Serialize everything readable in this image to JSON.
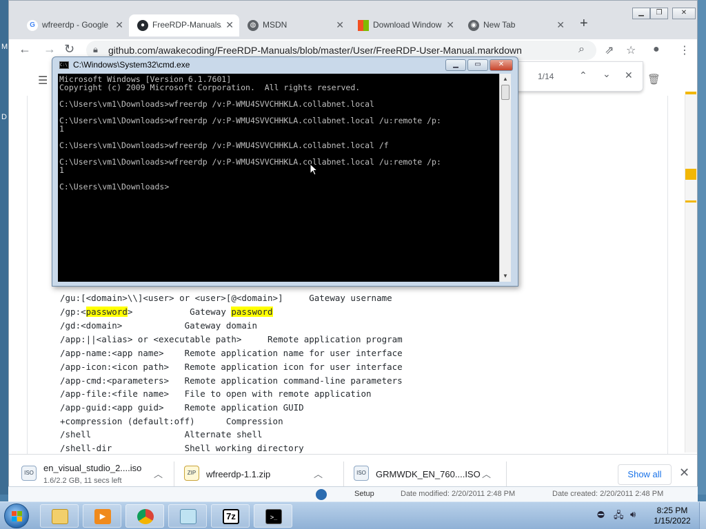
{
  "browser": {
    "tabs": [
      {
        "label": "wfreerdp - Google Search",
        "favicon": "google-icon"
      },
      {
        "label": "FreeRDP-Manuals/FreeRDP-User-Manual.markdown",
        "favicon": "github-icon",
        "active": true
      },
      {
        "label": "MSDN",
        "favicon": "globe-icon"
      },
      {
        "label": "Download Windows",
        "favicon": "microsoft-icon"
      },
      {
        "label": "New Tab",
        "favicon": "chrome-icon"
      }
    ],
    "url": "github.com/awakecoding/FreeRDP-Manuals/blob/master/User/FreeRDP-User-Manual.markdown",
    "find": {
      "count": "1/14"
    }
  },
  "manual": {
    "lines": [
      {
        "pre": "/gu:[<domain>\\\\]<user> or <user>[@<domain>]     Gateway username",
        "hl": "",
        "post": ""
      },
      {
        "pre": "/gp:<",
        "hl": "password",
        "mid": ">           Gateway ",
        "hl2": "password"
      },
      {
        "pre": "/gd:<domain>            Gateway domain",
        "hl": "",
        "post": ""
      },
      {
        "pre": "/app:||<alias> or <executable path>     Remote application program",
        "hl": "",
        "post": ""
      },
      {
        "pre": "/app-name:<app name>    Remote application name for user interface",
        "hl": "",
        "post": ""
      },
      {
        "pre": "/app-icon:<icon path>   Remote application icon for user interface",
        "hl": "",
        "post": ""
      },
      {
        "pre": "/app-cmd:<parameters>   Remote application command-line parameters",
        "hl": "",
        "post": ""
      },
      {
        "pre": "/app-file:<file name>   File to open with remote application",
        "hl": "",
        "post": ""
      },
      {
        "pre": "/app-guid:<app guid>    Remote application GUID",
        "hl": "",
        "post": ""
      },
      {
        "pre": "+compression (default:off)      Compression",
        "hl": "",
        "post": ""
      },
      {
        "pre": "/shell                  Alternate shell",
        "hl": "",
        "post": ""
      },
      {
        "pre": "/shell-dir              Shell working directory",
        "hl": "",
        "post": ""
      }
    ]
  },
  "cmd": {
    "title": "C:\\Windows\\System32\\cmd.exe",
    "lines": [
      "Microsoft Windows [Version 6.1.7601]",
      "Copyright (c) 2009 Microsoft Corporation.  All rights reserved.",
      "",
      "C:\\Users\\vm1\\Downloads>wfreerdp /v:P-WMU4SVVCHHKLA.collabnet.local",
      "",
      "C:\\Users\\vm1\\Downloads>wfreerdp /v:P-WMU4SVVCHHKLA.collabnet.local /u:remote /p:",
      "1",
      "",
      "C:\\Users\\vm1\\Downloads>wfreerdp /v:P-WMU4SVVCHHKLA.collabnet.local /f",
      "",
      "C:\\Users\\vm1\\Downloads>wfreerdp /v:P-WMU4SVVCHHKLA.collabnet.local /u:remote /p:",
      "1",
      "",
      "C:\\Users\\vm1\\Downloads>"
    ]
  },
  "downloads": {
    "items": [
      {
        "name": "en_visual_studio_2....iso",
        "status": "1.6/2.2 GB, 11 secs left"
      },
      {
        "name": "wfreerdp-1.1.zip",
        "status": ""
      },
      {
        "name": "GRMWDK_EN_760....ISO",
        "status": ""
      }
    ],
    "show_all": "Show all"
  },
  "desktop": {
    "behind_text": [
      "Setup",
      "Date modified: 2/20/2011 2:48 PM",
      "Date created: 2/20/2011 2:48 PM"
    ]
  },
  "taskbar": {
    "time": "8:25 PM",
    "date": "1/15/2022",
    "apps": [
      "explorer-icon",
      "media-player-icon",
      "chrome-icon",
      "notepad-icon",
      "7zip-icon",
      "cmd-icon"
    ],
    "sevenzip_label": "7z"
  },
  "colors": {
    "highlight": "#ffff00",
    "link": "#1a73e8",
    "console_bg": "#000000",
    "console_text": "#c0c0c0"
  }
}
